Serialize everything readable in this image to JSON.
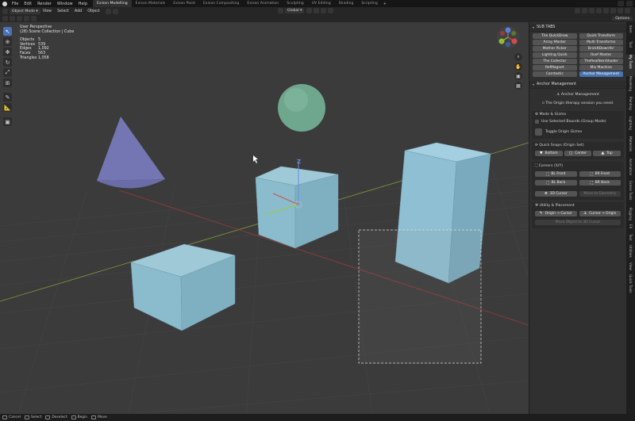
{
  "menubar": {
    "menus": [
      "File",
      "Edit",
      "Render",
      "Window",
      "Help"
    ],
    "workspaces": [
      {
        "label": "Exison Modelling",
        "active": true
      },
      {
        "label": "Exison Materials",
        "active": false
      },
      {
        "label": "Exison Paint",
        "active": false
      },
      {
        "label": "Exison Compositing",
        "active": false
      },
      {
        "label": "Exison Animation",
        "active": false
      },
      {
        "label": "Sculpting",
        "active": false
      },
      {
        "label": "UV Editing",
        "active": false
      },
      {
        "label": "Shading",
        "active": false
      },
      {
        "label": "Scripting",
        "active": false
      }
    ],
    "add_label": "+"
  },
  "header": {
    "mode": "Object Mode",
    "menus": [
      "View",
      "Select",
      "Add",
      "Object"
    ],
    "orientation": "Global"
  },
  "toolrow": {
    "options_label": "Options"
  },
  "viewport": {
    "view_name": "User Perspective",
    "collection": "(28) Scene Collection | Cube",
    "stats": [
      {
        "label": "Objects",
        "value": "5"
      },
      {
        "label": "Vertices",
        "value": "539"
      },
      {
        "label": "Edges",
        "value": "1,092"
      },
      {
        "label": "Faces",
        "value": "563"
      },
      {
        "label": "Triangles",
        "value": "1,058"
      }
    ],
    "gizmo_labels": {
      "z": "Z"
    }
  },
  "npanel": {
    "subtabs_title": "SUB TABS",
    "subtabs": [
      {
        "label": "The QuickDraw",
        "active": false
      },
      {
        "label": "Quick Transform",
        "active": false
      },
      {
        "label": "Array Master",
        "active": false
      },
      {
        "label": "Multi Transforms",
        "active": false
      },
      {
        "label": "Mother Picker",
        "active": false
      },
      {
        "label": "BrickItDownYo!",
        "active": false
      },
      {
        "label": "Lighting Quick",
        "active": false
      },
      {
        "label": "Roof Master",
        "active": false
      },
      {
        "label": "The Collector",
        "active": false
      },
      {
        "label": "TheRealSkinShader",
        "active": false
      },
      {
        "label": "RefMagnet",
        "active": false
      },
      {
        "label": "Mix Machine",
        "active": false
      },
      {
        "label": "Camtastic",
        "active": false
      },
      {
        "label": "Anchor Management",
        "active": true
      }
    ],
    "anchor": {
      "title": "Anchor Management",
      "subtitle": "Anchor Management",
      "tagline": "The Origin therapy session you need.",
      "mode_title": "Mode & Gizmo",
      "use_selected": "Use Selected Bounds (Group Mode)",
      "toggle_gizmo": "Toggle Origin Gizmo",
      "quick_snaps_title": "Quick Snaps (Origin Set)",
      "bottom": "Bottom",
      "center": "Center",
      "top": "Top",
      "corners_title": "Corners (X/Y)",
      "bl_front": "BL Front",
      "br_front": "BR Front",
      "bl_back": "BL Back",
      "br_back": "BR Back",
      "cursor_3d": "3D Cursor",
      "move_to_geometry": "Move to Geometry",
      "utility_title": "Utility & Placement",
      "origin_to_cursor": "Origin → Cursor",
      "cursor_to_origin": "Cursor → Origin",
      "move_object": "Move Object to 3D Cursor"
    }
  },
  "vtabs": [
    {
      "label": "Item",
      "active": false
    },
    {
      "label": "Tool",
      "active": false
    },
    {
      "label": "My Tools",
      "active": true
    },
    {
      "label": "Modeling",
      "active": false
    },
    {
      "label": "Painting",
      "active": false
    },
    {
      "label": "Lighting",
      "active": false
    },
    {
      "label": "Materials",
      "active": false
    },
    {
      "label": "Animation",
      "active": false
    },
    {
      "label": "Scene Tools",
      "active": false
    },
    {
      "label": "Rigging",
      "active": false
    },
    {
      "label": "FX",
      "active": false
    },
    {
      "label": "Text",
      "active": false
    },
    {
      "label": "Utilities",
      "active": false
    },
    {
      "label": "View",
      "active": false
    },
    {
      "label": "Quick Tools",
      "active": false
    }
  ],
  "statusbar": [
    {
      "key": "Esc",
      "label": "Cancel"
    },
    {
      "key": "LMB",
      "label": "Select"
    },
    {
      "key": "Shift",
      "label": "Deselect"
    },
    {
      "key": "MMB",
      "label": "Begin"
    },
    {
      "key": "Space",
      "label": "Move"
    }
  ],
  "colors": {
    "accent": "#4772b3",
    "viewport_bg": "#3b3b3b",
    "cube": "#7eaebf",
    "sphere": "#6fa78e",
    "cone": "#7476b3"
  }
}
